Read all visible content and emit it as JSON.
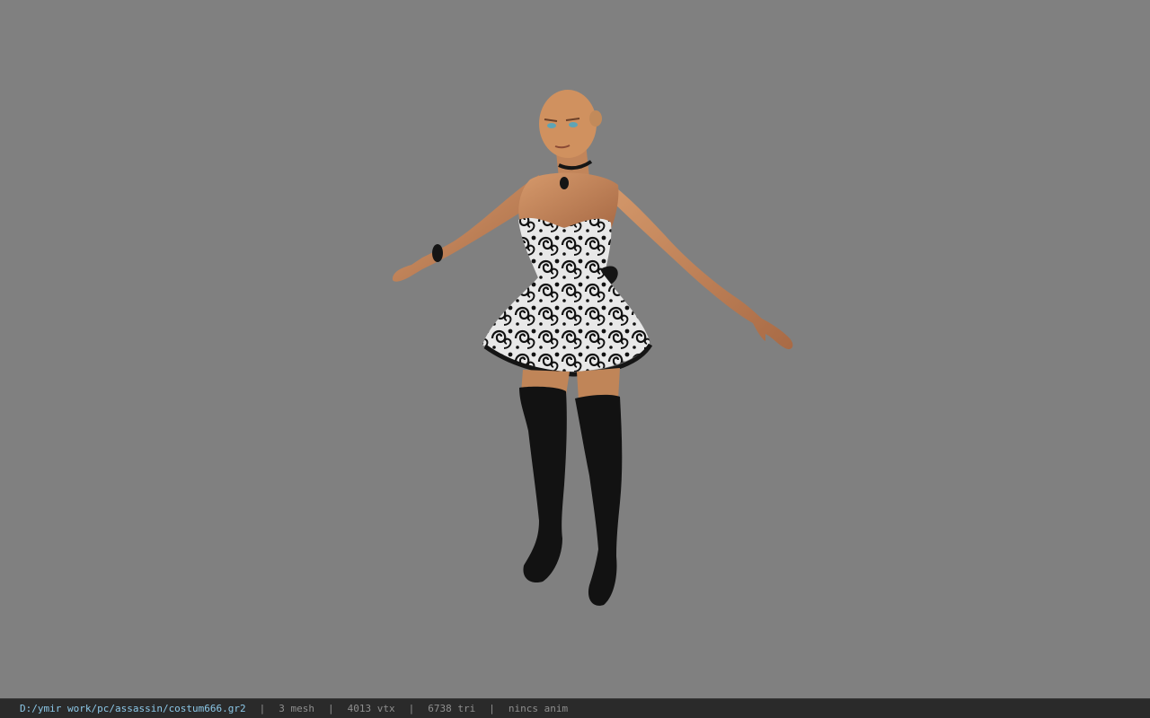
{
  "viewport": {
    "background_color": "#808080",
    "model_name": "costum666"
  },
  "status_bar": {
    "file_path": "D:/ymir work/pc/assassin/costum666.gr2",
    "mesh": "3 mesh",
    "vertices": "4013 vtx",
    "triangles": "6738 tri",
    "animation": "nincs anim",
    "separator": "|",
    "path_color": "#8cc8e8",
    "text_color": "#8f8f8f",
    "background_color": "#2a2a2a"
  }
}
